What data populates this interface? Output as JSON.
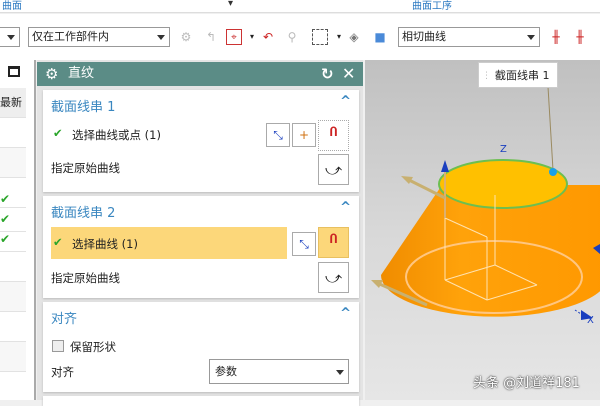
{
  "ribbon": {
    "left": "曲面",
    "right": "曲面工序"
  },
  "toolbar": {
    "scope": "仅在工作部件内",
    "curve_rule": "相切曲线"
  },
  "left_panel": {
    "header": "最新"
  },
  "dialog": {
    "title": "直纹",
    "section1": {
      "title": "截面线串 1",
      "select": "选择曲线或点 (1)",
      "origin": "指定原始曲线"
    },
    "section2": {
      "title": "截面线串 2",
      "select": "选择曲线 (1)",
      "origin": "指定原始曲线"
    },
    "align": {
      "title": "对齐",
      "keep_shape": "保留形状",
      "keep_shape_checked": false,
      "align_label": "对齐",
      "align_value": "参数"
    }
  },
  "viewport": {
    "tooltip": "截面线串 1",
    "axis_z": "Z",
    "axis_x": "X",
    "watermark": "头条 @刘道祥181"
  },
  "colors": {
    "accent": "#5b8c86",
    "highlight": "#fcd77a",
    "body": "#ffa000"
  }
}
